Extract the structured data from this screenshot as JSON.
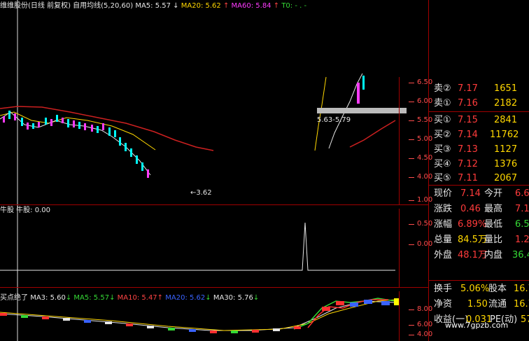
{
  "main_header": {
    "title": "维维股份(日线 前复权) 自用均线(5,20,60)",
    "ma5": "MA5: 5.57",
    "ma20": "MA20: 5.62",
    "ma60": "MA60: 5.84",
    "t0": "T0: - . -",
    "arrow_up": "↑",
    "arrow_down": "↓"
  },
  "price_axis": {
    "ticks": [
      "6.50",
      "6.00",
      "5.50",
      "5.00",
      "4.50",
      "4.00"
    ]
  },
  "annotations": {
    "low_marker": "←3.62",
    "range_label": "5.63-5.79"
  },
  "sub1": {
    "header": "牛股 牛股: 0.00",
    "ticks": [
      "1.00",
      "0.50",
      "0.00"
    ]
  },
  "sub2": {
    "name": "买点绝了",
    "ma3": "MA3: 5.60",
    "ma5": "MA5: 5.57",
    "ma10": "MA10: 5.47",
    "ma20": "MA20: 5.62",
    "ma30": "MA30: 5.76",
    "ticks": [
      "8.00",
      "6.00",
      "4.00"
    ]
  },
  "order_book": [
    {
      "label": "卖②",
      "price": "7.17",
      "vol": "1651"
    },
    {
      "label": "卖①",
      "price": "7.16",
      "vol": "2182"
    },
    {
      "label": "买①",
      "price": "7.15",
      "vol": "2841"
    },
    {
      "label": "买②",
      "price": "7.14",
      "vol": "11762"
    },
    {
      "label": "买③",
      "price": "7.13",
      "vol": "1127"
    },
    {
      "label": "买④",
      "price": "7.12",
      "vol": "1376"
    },
    {
      "label": "买⑤",
      "price": "7.11",
      "vol": "2067"
    }
  ],
  "stats": [
    {
      "l1": "现价",
      "v1": "7.14",
      "l2": "今开",
      "v2": "6.6"
    },
    {
      "l1": "涨跌",
      "v1": "0.46",
      "l2": "最高",
      "v2": "7.1"
    },
    {
      "l1": "涨幅",
      "v1": "6.89%",
      "l2": "最低",
      "v2": "6.5"
    },
    {
      "l1": "总量",
      "v1": "84.5万",
      "l2": "量比",
      "v2": "1.2"
    },
    {
      "l1": "外盘",
      "v1": "48.1万",
      "l2": "内盘",
      "v2": "36.4"
    },
    {
      "l1": "换手",
      "v1": "5.06%",
      "l2": "股本",
      "v2": "16.7"
    },
    {
      "l1": "净资",
      "v1": "1.50",
      "l2": "流通",
      "v2": "16.7"
    },
    {
      "l1": "收益(一)",
      "v1": "0.031",
      "l2": "PE(动)",
      "v2": "57."
    }
  ],
  "colors": {
    "up": "#ff3bff",
    "down": "#00ffff",
    "ma_white": "#e6e6e6",
    "ma_yellow": "#ffd700",
    "ma_red": "#cc2020"
  },
  "watermark": "www.7gpzb.com"
}
